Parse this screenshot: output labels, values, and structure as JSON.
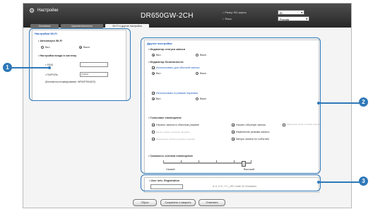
{
  "window": {
    "title": "Настройки",
    "model": "DR650GW-2CH",
    "sd_label": "Разър SD-карты",
    "sd_value": "E\\",
    "lang_label": "Язык",
    "lang_value": "Россия"
  },
  "tabs": [
    "Основные",
    "Чувствительность",
    "Wi-Fi и другие настройки"
  ],
  "wifi": {
    "title": "Настройки Wi-Fi",
    "auto_label": "Автозапуск Wi-Fi",
    "on": "Вкл.",
    "off": "Выкл",
    "login_label": "Настройка входа в систему",
    "ssid_label": "SSID",
    "pwd_label": "ПАРОЛЬ",
    "pwd_value": "••••••••",
    "security": "(Безопасность/шифрование: WPA2PSK/AES)"
  },
  "other": {
    "title": "Другие настройки",
    "rec_indicator": "Индикатор статуса записи",
    "on": "Вкл.",
    "off": "Выкл",
    "sec_indicator": "Индикатор безопасности",
    "use_normal": "Использовать для обычной записи",
    "use_parking": "Использовать в режиме парковки",
    "voice": "Голосовое оповещение",
    "checks": [
      "Начало записи в обычном режиме",
      "Начать обычную запись",
      "Завершение записи в режиме парковки",
      "Начать запись в режиме парковки",
      "Изменение режима записи",
      "Завершение записи в режиме парковки",
      "Запуск записи по событию",
      "Завершение записи по событию",
      "Завершение сеанса"
    ],
    "volume_label": "Громкость сигнала оповещения",
    "vol_min": "Низкий",
    "vol_max": "Высокий"
  },
  "user_info": {
    "label": "User info. Registration",
    "hint": "A~Z, 0~9, -!?+-_200. Under 20 Characters"
  },
  "buttons": {
    "reset": "Сброс",
    "save": "Сохранить и закрыть",
    "cancel": "Отменить"
  },
  "callouts": [
    "1",
    "2",
    "3"
  ],
  "colors": {
    "accent": "#2e78b8",
    "panel_title": "#1f5fbf"
  },
  "volume_level": 0.92
}
